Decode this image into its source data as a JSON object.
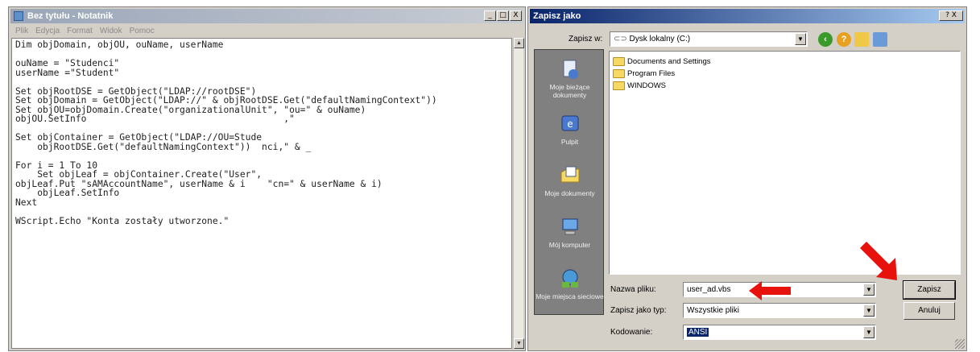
{
  "notepad": {
    "title": "Bez tytułu - Notatnik",
    "menu": [
      "Plik",
      "Edycja",
      "Format",
      "Widok",
      "Pomoc"
    ],
    "window_buttons": [
      "_",
      "□",
      "X"
    ],
    "code_lines": [
      "Dim objDomain, objOU, ouName, userName",
      "",
      "ouName = \"Studenci\"",
      "userName =\"Student\"",
      "",
      "Set objRootDSE = GetObject(\"LDAP://rootDSE\")",
      "Set objDomain = GetObject(\"LDAP://\" & objRootDSE.Get(\"defaultNamingContext\"))",
      "Set objOU=objDomain.Create(\"organizationalUnit\", \"ou=\" & ouName)",
      "objOU.SetInfo                                    ,\"",
      "",
      "Set objContainer = GetObject(\"LDAP://OU=Stude",
      "    objRootDSE.Get(\"defaultNamingContext\"))  nci,\" & _",
      "",
      "For i = 1 To 10",
      "    Set objLeaf = objContainer.Create(\"User\",",
      "objLeaf.Put \"sAMAccountName\", userName & i    \"cn=\" & userName & i)",
      "    objLeaf.SetInfo",
      "Next",
      "",
      "WScript.Echo \"Konta zostały utworzone.\""
    ]
  },
  "dialog": {
    "title": "Zapisz jako",
    "help_close": "? X",
    "save_in_label": "Zapisz w:",
    "save_in_value": "Dysk lokalny (C:)",
    "places": [
      {
        "label": "Moje bieżące dokumenty",
        "icon": "recent-documents-icon"
      },
      {
        "label": "Pulpit",
        "icon": "desktop-icon"
      },
      {
        "label": "Moje dokumenty",
        "icon": "my-documents-icon"
      },
      {
        "label": "Mój komputer",
        "icon": "my-computer-icon"
      },
      {
        "label": "Moje miejsca sieciowe",
        "icon": "network-places-icon"
      }
    ],
    "files": [
      "Documents and Settings",
      "Program Files",
      "WINDOWS"
    ],
    "filename_label": "Nazwa pliku:",
    "filename_value": "user_ad.vbs",
    "filetype_label": "Zapisz jako typ:",
    "filetype_value": "Wszystkie pliki",
    "encoding_label": "Kodowanie:",
    "encoding_value": "ANSI",
    "save_button": "Zapisz",
    "cancel_button": "Anuluj"
  },
  "colors": {
    "annotation_arrow": "#e8120c",
    "title_active": "#0a246a",
    "title_inactive": "#9aa6b8"
  }
}
